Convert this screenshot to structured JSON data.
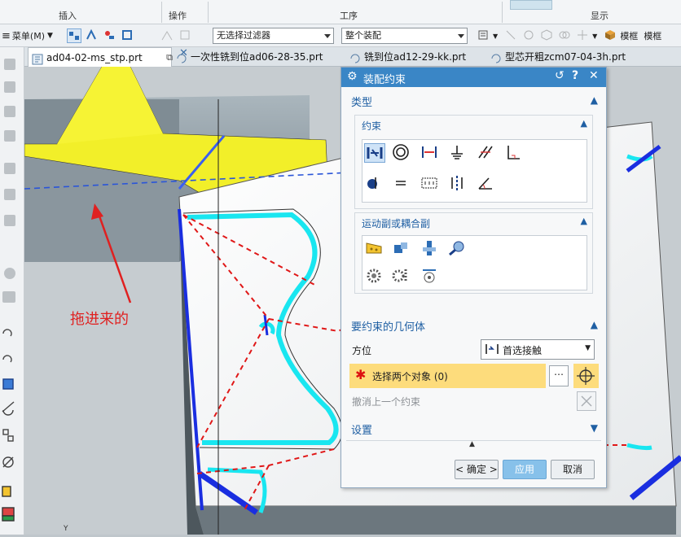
{
  "ribbon": {
    "groups": [
      "插入",
      "操作",
      "工序",
      "显示"
    ]
  },
  "toolbar": {
    "menu_label": "菜单(M)",
    "filter_value": "无选择过滤器",
    "assembly_value": "整个装配",
    "right_labels": [
      "模框",
      "模框"
    ]
  },
  "tabs": [
    {
      "label": "ad04-02-ms_stp.prt"
    },
    {
      "label": "一次性铣到位ad06-28-35.prt"
    },
    {
      "label": "铣到位ad12-29-kk.prt"
    },
    {
      "label": "型芯开粗zcm07-04-3h.prt"
    }
  ],
  "annotation": "拖进来的",
  "dialog": {
    "title": "装配约束",
    "type_header": "类型",
    "constraint_header": "约束",
    "motion_header": "运动副或耦合副",
    "geometry_header": "要约束的几何体",
    "orientation_label": "方位",
    "orientation_value": "首选接触",
    "select_label": "选择两个对象 (0)",
    "undo_label": "撤消上一个约束",
    "settings_header": "设置",
    "ok_label": "< 确定 >",
    "apply_label": "应用",
    "cancel_label": "取消"
  },
  "colors": {
    "accent": "#3a86c6",
    "highlight": "#fddc7c",
    "annotation": "#e02020",
    "model_yellow": "#f5f02a",
    "edge_cyan": "#19e6f0",
    "edge_blue": "#1a2ee0"
  }
}
